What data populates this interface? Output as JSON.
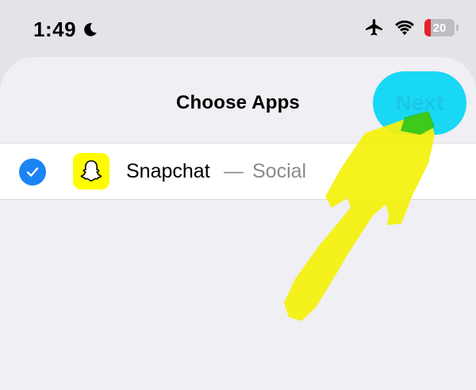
{
  "status_bar": {
    "time": "1:49",
    "battery_percent": "20",
    "icons": [
      "moon-icon",
      "airplane-icon",
      "wifi-icon",
      "battery-icon"
    ]
  },
  "sheet": {
    "title": "Choose Apps",
    "next_label": "Next"
  },
  "apps": [
    {
      "name": "Snapchat",
      "separator": "—",
      "category": "Social",
      "selected": true,
      "icon": "snapchat-icon"
    }
  ],
  "annotation": {
    "type": "yellow-arrow",
    "color": "#f5f10a",
    "points_to": "next-button"
  },
  "colors": {
    "next_button_highlight": "#19d8f5",
    "checkbox_blue": "#1a84f5",
    "snapchat_yellow": "#fffc00",
    "battery_low": "#e8202a"
  }
}
